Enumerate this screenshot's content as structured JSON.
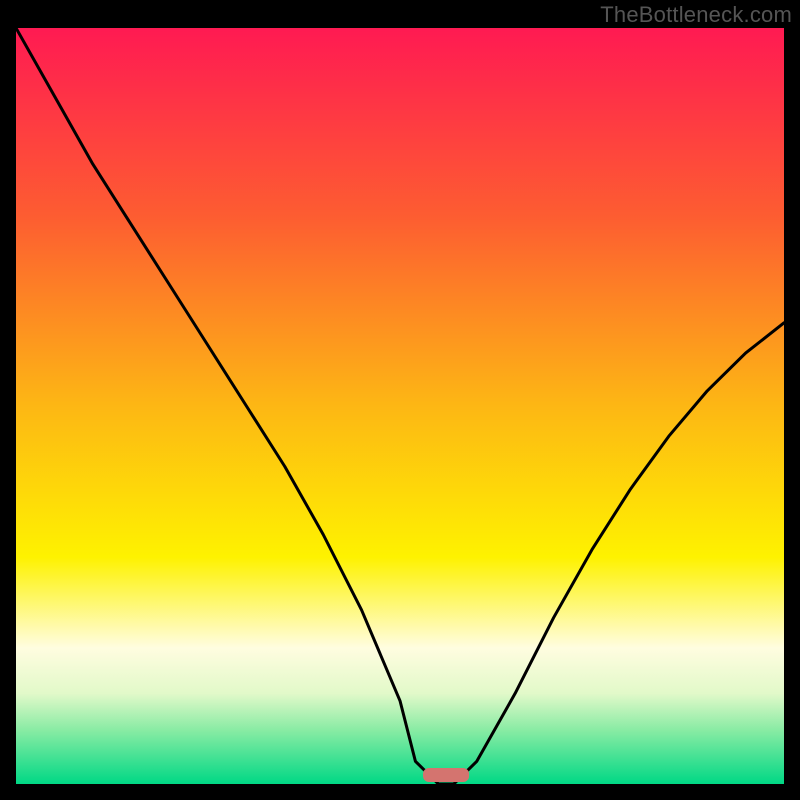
{
  "watermark": "TheBottleneck.com",
  "chart_data": {
    "type": "line",
    "title": "",
    "xlabel": "",
    "ylabel": "",
    "xlim": [
      0,
      100
    ],
    "ylim": [
      0,
      100
    ],
    "grid": false,
    "legend": false,
    "background_gradient": {
      "stops": [
        {
          "offset": 0.0,
          "color": "#ff1a52"
        },
        {
          "offset": 0.25,
          "color": "#fd5d31"
        },
        {
          "offset": 0.5,
          "color": "#fdb714"
        },
        {
          "offset": 0.7,
          "color": "#fef200"
        },
        {
          "offset": 0.82,
          "color": "#fffde0"
        },
        {
          "offset": 0.88,
          "color": "#e2f9c9"
        },
        {
          "offset": 0.93,
          "color": "#86eba3"
        },
        {
          "offset": 1.0,
          "color": "#00d885"
        }
      ]
    },
    "series": [
      {
        "name": "bottleneck-curve",
        "x": [
          0,
          5,
          10,
          15,
          20,
          25,
          30,
          35,
          40,
          45,
          50,
          52,
          55,
          57,
          60,
          65,
          70,
          75,
          80,
          85,
          90,
          95,
          100
        ],
        "y": [
          100,
          91,
          82,
          74,
          66,
          58,
          50,
          42,
          33,
          23,
          11,
          3,
          0,
          0,
          3,
          12,
          22,
          31,
          39,
          46,
          52,
          57,
          61
        ]
      }
    ],
    "marker": {
      "x": 56,
      "y": 0,
      "w": 6,
      "h": 2,
      "color": "#d4746f"
    }
  }
}
